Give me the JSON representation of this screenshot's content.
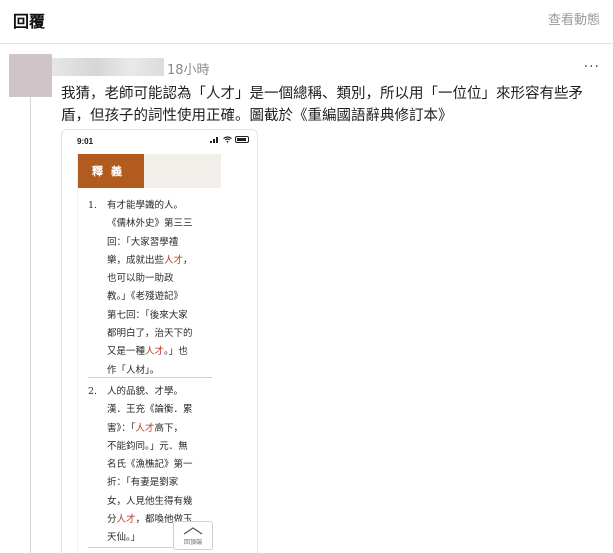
{
  "header": {
    "title": "回覆",
    "view_activity": "查看動態"
  },
  "post": {
    "time": "18小時",
    "more_label": "···",
    "body_lines": [
      "我猜，老師可能認為「人才」是一個總稱、類別，所以用「一位位」來形容有些矛",
      "盾，但孩子的詞性使用正確。圖截於《重編國語辭典修訂本》"
    ]
  },
  "embed": {
    "status_time": "9:01",
    "tab_label": "釋義",
    "definitions": [
      {
        "num": "1.",
        "lines": [
          [
            {
              "t": "有才能學識的人。"
            }
          ],
          [
            {
              "t": "《儒林外史》第三三"
            }
          ],
          [
            {
              "t": "回：「大家習學禮"
            }
          ],
          [
            {
              "t": "樂，成就出些"
            },
            {
              "t": "人才",
              "h": true
            },
            {
              "t": "，"
            }
          ],
          [
            {
              "t": "也可以助一助政"
            }
          ],
          [
            {
              "t": "教。」《老殘遊記》"
            }
          ],
          [
            {
              "t": "第七回：「後來大家"
            }
          ],
          [
            {
              "t": "都明白了，治天下的"
            }
          ],
          [
            {
              "t": "又是一種"
            },
            {
              "t": "人才",
              "h": true
            },
            {
              "t": "。」也"
            }
          ],
          [
            {
              "t": "作「人材」。"
            }
          ]
        ]
      },
      {
        "num": "2.",
        "lines": [
          [
            {
              "t": "人的品貌、才學。"
            }
          ],
          [
            {
              "t": "漢．王充《論衡．累"
            }
          ],
          [
            {
              "t": "害》：「"
            },
            {
              "t": "人才",
              "h": true
            },
            {
              "t": "高下，"
            }
          ],
          [
            {
              "t": "不能鈞同。」元．無"
            }
          ],
          [
            {
              "t": "名氏《漁樵記》第一"
            }
          ],
          [
            {
              "t": "折：「有妻是劉家"
            }
          ],
          [
            {
              "t": "女，人見他生得有幾"
            }
          ],
          [
            {
              "t": "分"
            },
            {
              "t": "人才",
              "h": true
            },
            {
              "t": "，都喚他做玉"
            }
          ],
          [
            {
              "t": "天仙。」"
            }
          ]
        ]
      }
    ],
    "back_to_top": "回頂端"
  },
  "colors": {
    "tab_brown": "#b15c1e",
    "highlight_red": "#c0392b"
  }
}
